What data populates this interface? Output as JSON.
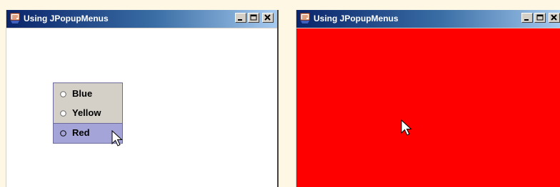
{
  "windows": [
    {
      "title": "Using JPopupMenus",
      "background": "#ffffff",
      "popup_menu": {
        "items": [
          {
            "label": "Blue",
            "icon": "radio-unselected-icon",
            "highlighted": false
          },
          {
            "label": "Yellow",
            "icon": "radio-unselected-icon",
            "highlighted": false
          },
          {
            "label": "Red",
            "icon": "radio-unselected-icon",
            "highlighted": true
          }
        ]
      }
    },
    {
      "title": "Using JPopupMenus",
      "background": "#ff0000"
    }
  ],
  "colors": {
    "titlebar_start": "#0a246a",
    "titlebar_end": "#a6caf0",
    "menu_background": "#d4d0c8",
    "menu_highlight": "#a4a4d8",
    "selected_color": "#ff0000"
  }
}
